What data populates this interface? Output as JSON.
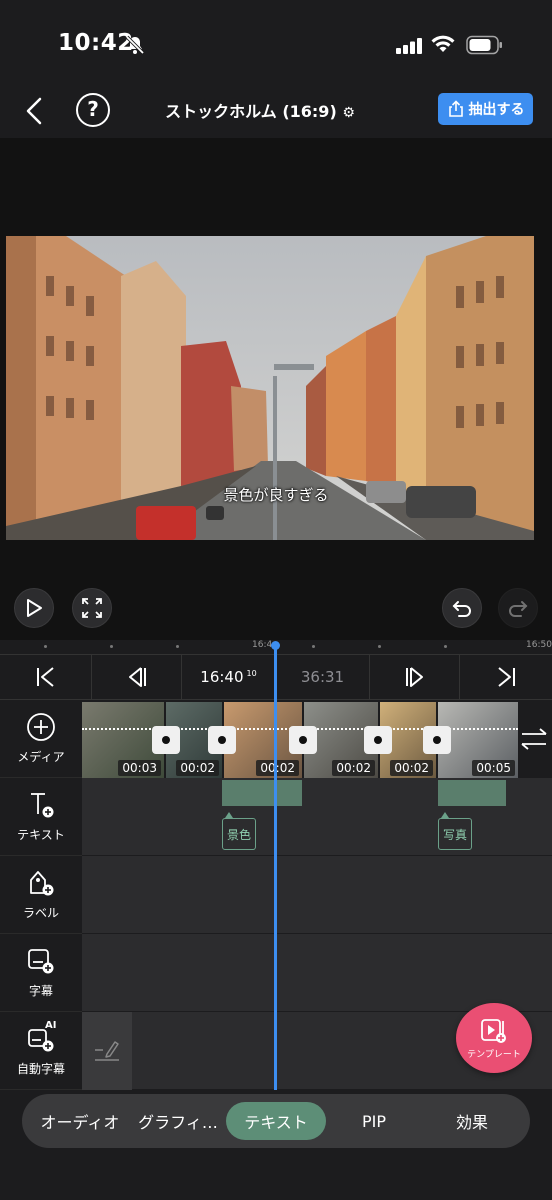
{
  "status_bar": {
    "time": "10:42"
  },
  "toolbar": {
    "title": "ストックホルム (16:9)",
    "export_label": "抽出する"
  },
  "preview": {
    "caption": "景色が良すぎる"
  },
  "ruler": {
    "left_label": "16:4",
    "right_label": "16:50"
  },
  "transport": {
    "current_time": "16:40",
    "current_frames": "10",
    "total_time": "36:31"
  },
  "tracks": {
    "media": {
      "label": "メディア",
      "clip_durations": [
        "00:03",
        "00:02",
        "00:02",
        "00:02",
        "00:02",
        "00:05"
      ]
    },
    "text": {
      "label": "テキスト",
      "items": [
        "景色",
        "写真"
      ]
    },
    "label_track": {
      "label": "ラベル"
    },
    "subtitle": {
      "label": "字幕"
    },
    "auto_subtitle": {
      "label": "自動字幕",
      "badge": "AI"
    }
  },
  "template_button": {
    "label": "テンプレート"
  },
  "tabs": [
    {
      "label": "オーディオ"
    },
    {
      "label": "グラフィ…"
    },
    {
      "label": "テキスト"
    },
    {
      "label": "PIP"
    },
    {
      "label": "効果"
    }
  ],
  "active_tab": "テキスト",
  "colors": {
    "accent": "#3d8ef0",
    "active_tab": "#5d8e77",
    "template": "#ea4f73",
    "text_clip": "#5a7e6c"
  }
}
